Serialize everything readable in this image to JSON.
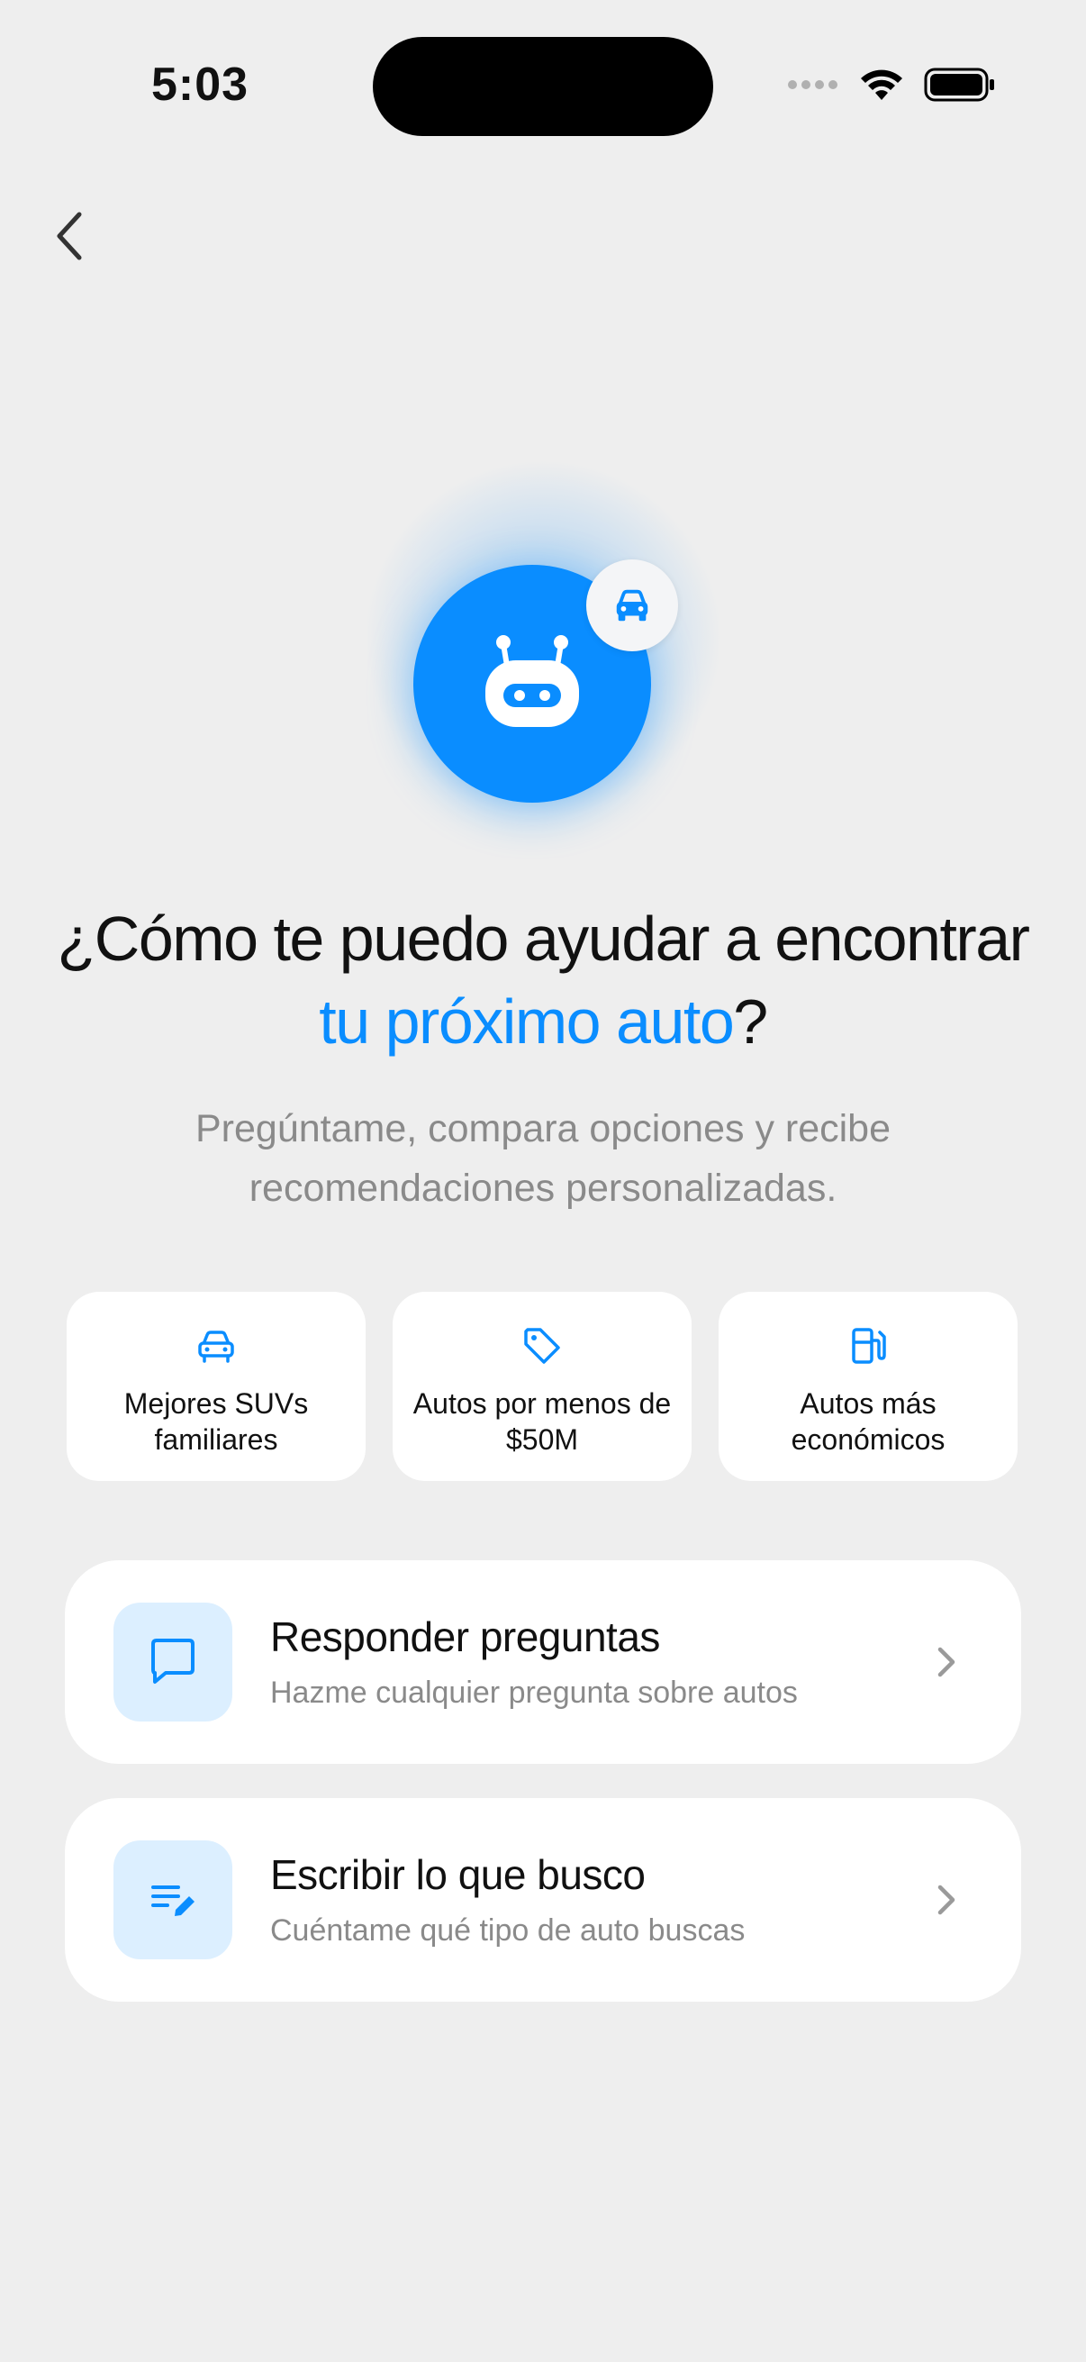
{
  "status_bar": {
    "time": "5:03"
  },
  "header": {
    "back_icon": "chevron-left-icon"
  },
  "hero": {
    "icon": "robot-icon",
    "badge_icon": "car-icon",
    "accent": "#0a8dff"
  },
  "headline": {
    "part1": "¿Cómo te puedo ayudar a encontrar ",
    "highlight": "tu próximo auto",
    "part2": "?"
  },
  "subtitle": "Pregúntame, compara opciones y recibe recomendaciones personalizadas.",
  "suggestions": [
    {
      "icon": "car-icon",
      "label": "Mejores SUVs familiares"
    },
    {
      "icon": "tag-icon",
      "label": "Autos por menos de $50M"
    },
    {
      "icon": "fuel-pump-icon",
      "label": "Autos más económicos"
    }
  ],
  "actions": [
    {
      "icon": "chat-bubble-icon",
      "title": "Responder preguntas",
      "subtitle": "Hazme cualquier pregunta sobre autos"
    },
    {
      "icon": "edit-list-icon",
      "title": "Escribir lo que busco",
      "subtitle": "Cuéntame qué tipo de auto buscas"
    }
  ]
}
